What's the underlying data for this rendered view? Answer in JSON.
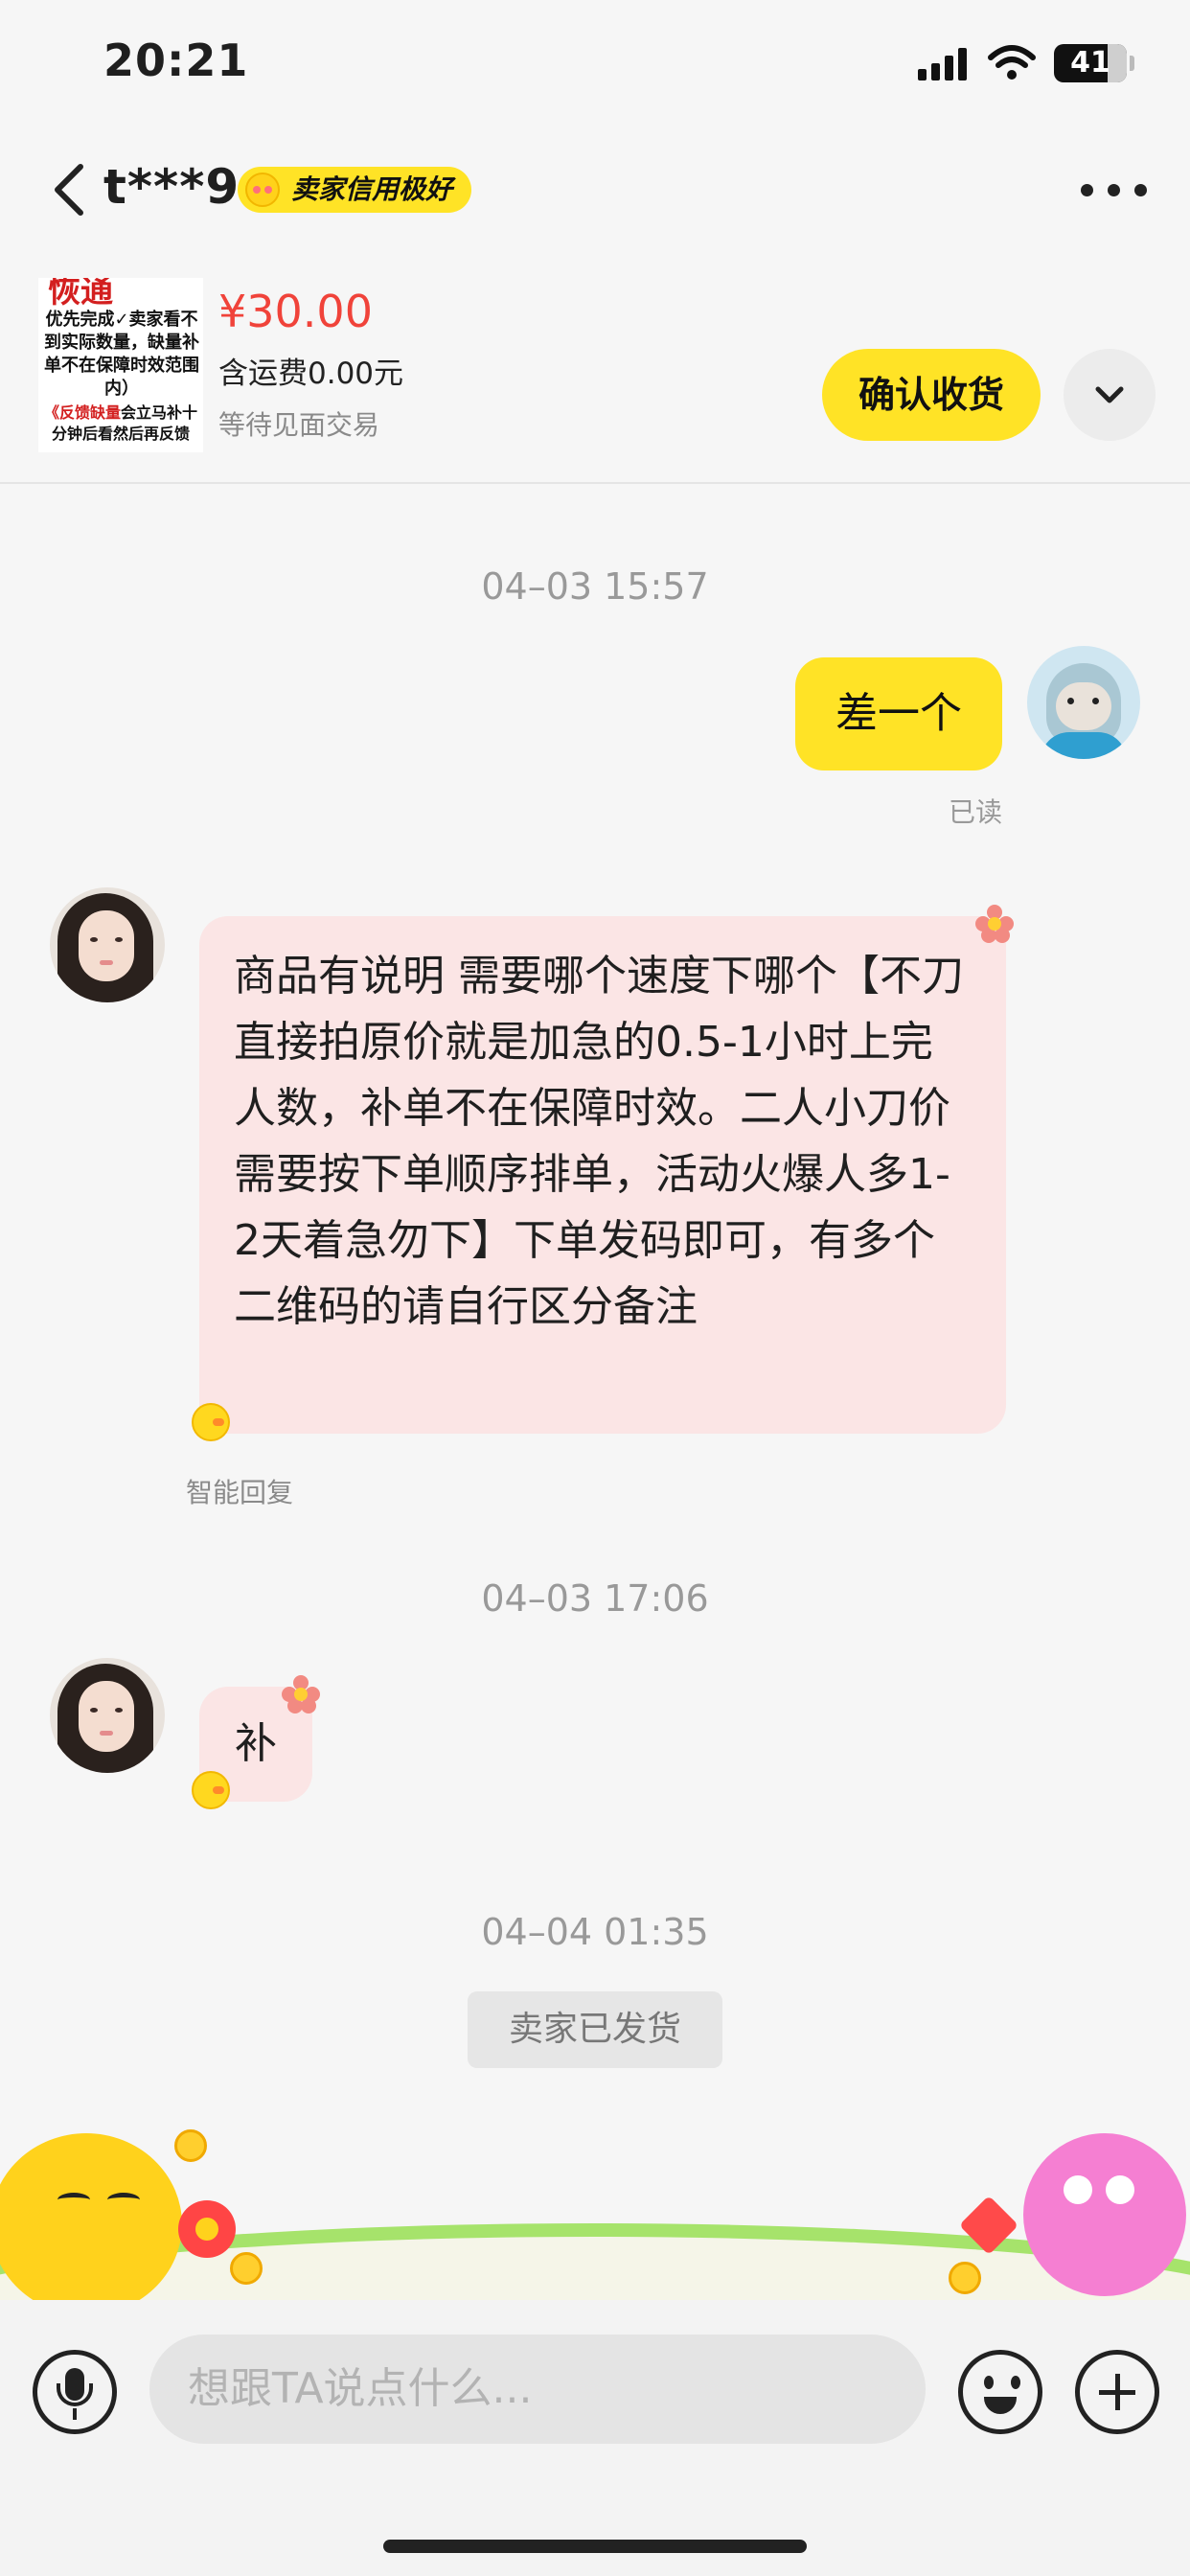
{
  "status_bar": {
    "time": "20:21",
    "battery": "41",
    "icons": [
      "signal-icon",
      "wifi-icon",
      "battery-icon"
    ]
  },
  "header": {
    "username": "t***9",
    "credit_badge": "卖家信用极好",
    "icons": [
      "back-icon",
      "more-icon"
    ]
  },
  "product": {
    "thumb_title": "恢通",
    "thumb_text": "优先完成✓卖家看不到实际数量，缺量补单不在保障时效范围内）",
    "thumb_red": "《反馈缺量",
    "thumb_footer": "会立马补十分钟后看然后再反馈",
    "price": "¥30.00",
    "shipping": "含运费0.00元",
    "status": "等待见面交易",
    "confirm_button": "确认收货"
  },
  "messages": {
    "ts1": "04–03 15:57",
    "me_text": "差一个",
    "read_receipt": "已读",
    "her_text1": "商品有说明 需要哪个速度下哪个【不刀直接拍原价就是加急的0.5-1小时上完人数，补单不在保障时效。二人小刀价需要按下单顺序排单，活动火爆人多1-2天着急勿下】下单发码即可，有多个二维码的请自行区分备注",
    "smart_reply": "智能回复",
    "ts2": "04–03 17:06",
    "her_text2": "补",
    "ts3": "04–04 01:35",
    "system_notice": "卖家已发货"
  },
  "input": {
    "placeholder": "想跟TA说点什么...",
    "icons": [
      "microphone-icon",
      "emoji-icon",
      "plus-icon"
    ]
  },
  "colors": {
    "accent_yellow": "#ffe326",
    "price_red": "#f0433a",
    "bubble_pink": "#fbe5e5",
    "background": "#f6f6f6"
  }
}
